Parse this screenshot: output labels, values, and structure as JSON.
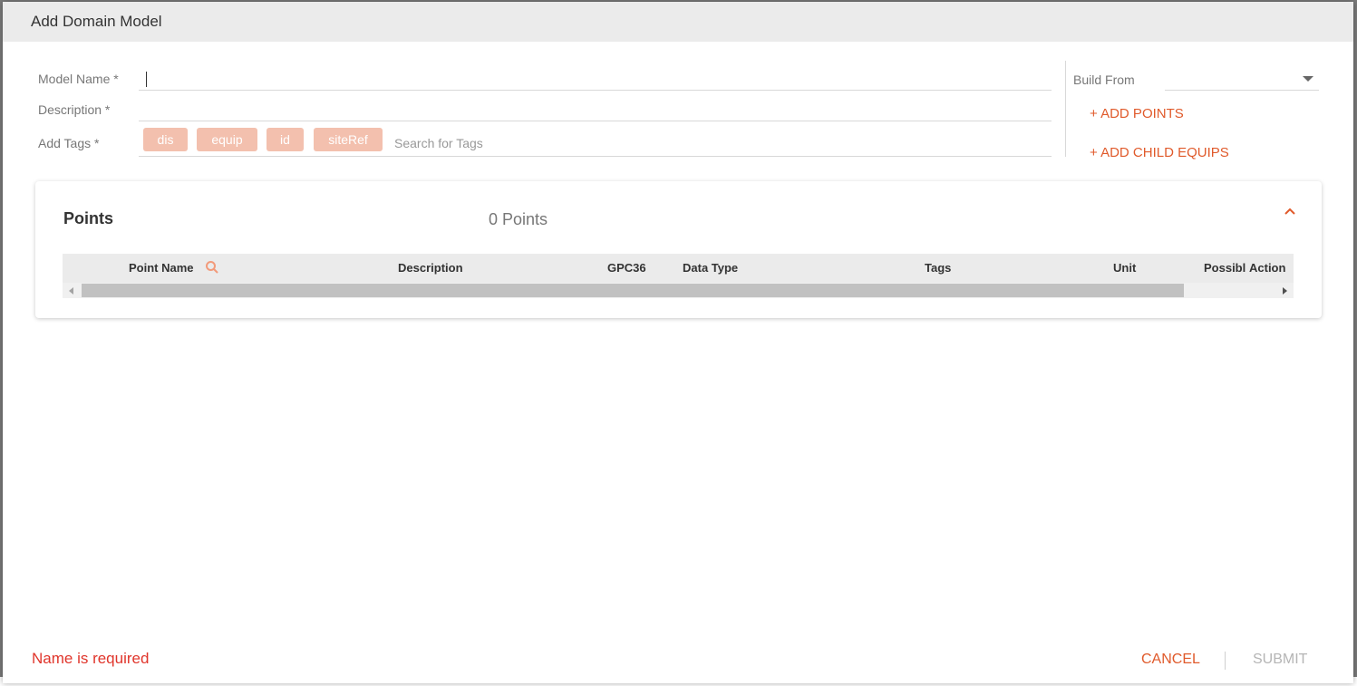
{
  "dialog": {
    "title": "Add Domain Model"
  },
  "form": {
    "model_name_label": "Model Name *",
    "model_name_value": "",
    "description_label": "Description *",
    "description_value": "",
    "tags_label": "Add Tags *",
    "tags": [
      "dis",
      "equip",
      "id",
      "siteRef"
    ],
    "tag_search_placeholder": "Search for Tags"
  },
  "build": {
    "label": "Build From",
    "selected": "",
    "add_points_label": "+ ADD POINTS",
    "add_child_equips_label": "+ ADD CHILD EQUIPS"
  },
  "points": {
    "title": "Points",
    "count_text": "0 Points",
    "columns": [
      "Point Name",
      "Description",
      "GPC36",
      "Data Type",
      "Tags",
      "Unit",
      "Possibl",
      "Action"
    ],
    "rows": []
  },
  "footer": {
    "error_text": "Name is required",
    "cancel_label": "CANCEL",
    "submit_label": "SUBMIT"
  },
  "colors": {
    "accent": "#e05a2b",
    "error": "#e0352b",
    "tag_chip": "#f3c0ae",
    "header_bg": "#ebebeb"
  },
  "icons": {
    "search": "search-icon",
    "collapse": "chevron-up-icon",
    "dropdown": "caret-down-icon"
  }
}
